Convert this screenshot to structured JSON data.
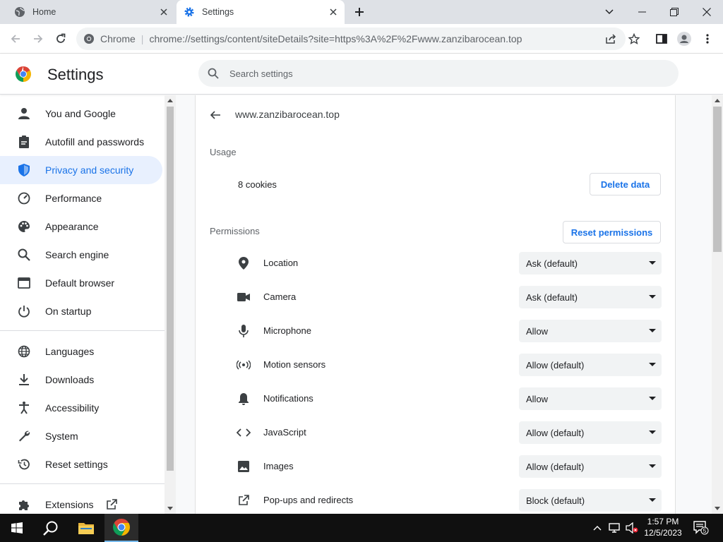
{
  "browser": {
    "tabs": [
      {
        "title": "Home",
        "active": false
      },
      {
        "title": "Settings",
        "active": true
      }
    ],
    "chip": "Chrome",
    "url": "chrome://settings/content/siteDetails?site=https%3A%2F%2Fwww.zanzibarocean.top"
  },
  "header": {
    "title": "Settings",
    "search_placeholder": "Search settings"
  },
  "sidebar": {
    "items": [
      {
        "label": "You and Google",
        "icon": "person-icon"
      },
      {
        "label": "Autofill and passwords",
        "icon": "clipboard-icon"
      },
      {
        "label": "Privacy and security",
        "icon": "shield-icon",
        "active": true
      },
      {
        "label": "Performance",
        "icon": "speedometer-icon"
      },
      {
        "label": "Appearance",
        "icon": "palette-icon"
      },
      {
        "label": "Search engine",
        "icon": "search-icon"
      },
      {
        "label": "Default browser",
        "icon": "browser-icon"
      },
      {
        "label": "On startup",
        "icon": "power-icon"
      },
      {
        "label": "Languages",
        "icon": "globe-icon"
      },
      {
        "label": "Downloads",
        "icon": "download-icon"
      },
      {
        "label": "Accessibility",
        "icon": "accessibility-icon"
      },
      {
        "label": "System",
        "icon": "wrench-icon"
      },
      {
        "label": "Reset settings",
        "icon": "history-icon"
      },
      {
        "label": "Extensions",
        "icon": "puzzle-icon"
      }
    ]
  },
  "site": {
    "title": "www.zanzibarocean.top",
    "usage_label": "Usage",
    "cookies": "8 cookies",
    "delete_label": "Delete data",
    "permissions_label": "Permissions",
    "reset_label": "Reset permissions",
    "permissions": [
      {
        "label": "Location",
        "value": "Ask (default)",
        "icon": "location-pin-icon"
      },
      {
        "label": "Camera",
        "value": "Ask (default)",
        "icon": "camera-icon"
      },
      {
        "label": "Microphone",
        "value": "Allow",
        "icon": "microphone-icon"
      },
      {
        "label": "Motion sensors",
        "value": "Allow (default)",
        "icon": "motion-sensor-icon"
      },
      {
        "label": "Notifications",
        "value": "Allow",
        "icon": "bell-icon"
      },
      {
        "label": "JavaScript",
        "value": "Allow (default)",
        "icon": "code-icon"
      },
      {
        "label": "Images",
        "value": "Allow (default)",
        "icon": "image-icon"
      },
      {
        "label": "Pop-ups and redirects",
        "value": "Block (default)",
        "icon": "external-link-icon"
      }
    ]
  },
  "taskbar": {
    "time": "1:57 PM",
    "date": "12/5/2023",
    "notification_count": "5"
  }
}
